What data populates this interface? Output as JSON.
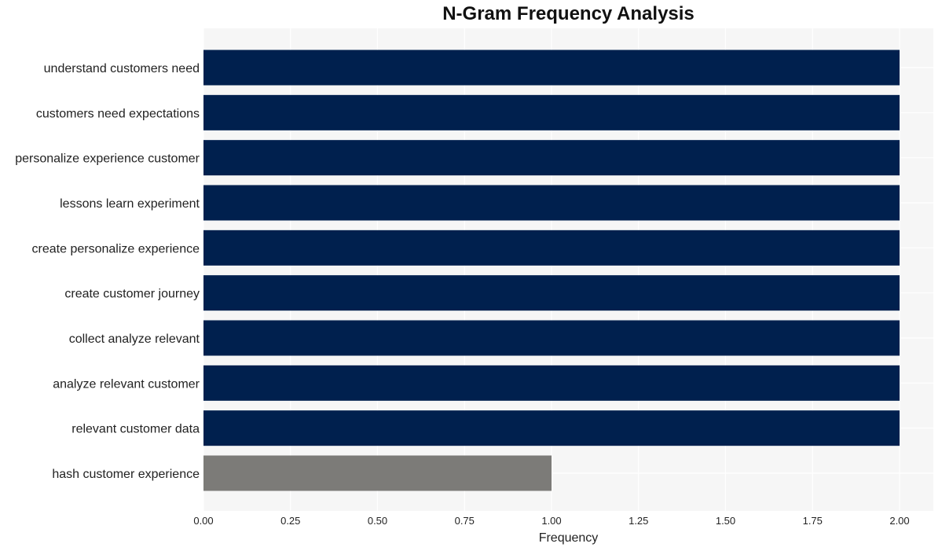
{
  "chart_data": {
    "type": "bar",
    "orientation": "horizontal",
    "title": "N-Gram Frequency Analysis",
    "xlabel": "Frequency",
    "ylabel": "",
    "xlim": [
      0,
      2.1
    ],
    "grid": true,
    "legend": "none",
    "xticks": [
      "0.00",
      "0.25",
      "0.50",
      "0.75",
      "1.00",
      "1.25",
      "1.50",
      "1.75",
      "2.00"
    ],
    "categories": [
      "understand customers need",
      "customers need expectations",
      "personalize experience customer",
      "lessons learn experiment",
      "create personalize experience",
      "create customer journey",
      "collect analyze relevant",
      "analyze relevant customer",
      "relevant customer data",
      "hash customer experience"
    ],
    "values": [
      2,
      2,
      2,
      2,
      2,
      2,
      2,
      2,
      2,
      1
    ],
    "colors": [
      "#00204e",
      "#00204e",
      "#00204e",
      "#00204e",
      "#00204e",
      "#00204e",
      "#00204e",
      "#00204e",
      "#00204e",
      "#7c7b78"
    ]
  },
  "style": {
    "plot_bg": "#f6f6f6",
    "grid_color": "#ffffff"
  }
}
